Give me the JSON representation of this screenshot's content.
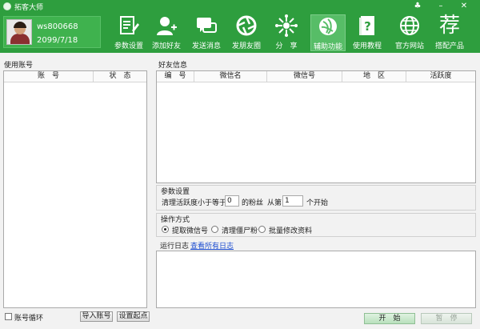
{
  "app": {
    "title": "拓客大师"
  },
  "profile": {
    "account": "ws800668",
    "expire_date": "2099/7/18"
  },
  "toolbar": [
    {
      "label": "参数设置",
      "icon": "document-edit-icon"
    },
    {
      "label": "添加好友",
      "icon": "add-user-icon"
    },
    {
      "label": "发送消息",
      "icon": "chat-bubbles-icon"
    },
    {
      "label": "发朋友圈",
      "icon": "camera-shutter-icon"
    },
    {
      "label": "分　享",
      "icon": "share-hub-icon"
    },
    {
      "label": "辅助功能",
      "icon": "camera-lens-icon"
    },
    {
      "label": "使用教程",
      "icon": "question-book-icon"
    },
    {
      "label": "官方网站",
      "icon": "globe-icon"
    },
    {
      "label": "搭配产品",
      "icon": "recommend-char-icon",
      "glyph": "荐"
    }
  ],
  "accounts": {
    "section_label": "使用账号",
    "columns": [
      "账　号",
      "状　态"
    ]
  },
  "friends": {
    "section_label": "好友信息",
    "columns": [
      "编　号",
      "微信名",
      "微信号",
      "地　区",
      "活跃度"
    ]
  },
  "params": {
    "section_label": "参数设置",
    "clean_prefix": "清理活跃度小于等于",
    "threshold_value": "0",
    "clean_mid": "的粉丝",
    "from_label": "从第",
    "start_value": "1",
    "start_suffix": "个开始"
  },
  "mode": {
    "section_label": "操作方式",
    "options": [
      "提取微信号",
      "清理僵尸粉",
      "批量修改资料"
    ],
    "selected": "提取微信号"
  },
  "log": {
    "label": "运行日志",
    "view_all_link": "查看所有日志"
  },
  "footer": {
    "loop_label": "账号循环",
    "import_button": "导入账号",
    "set_start_button": "设置起点",
    "start_button": "开　始",
    "pause_button": "暂　停"
  },
  "colors": {
    "brand_green": "#2e9e3e",
    "link_blue": "#1f4fd0"
  }
}
